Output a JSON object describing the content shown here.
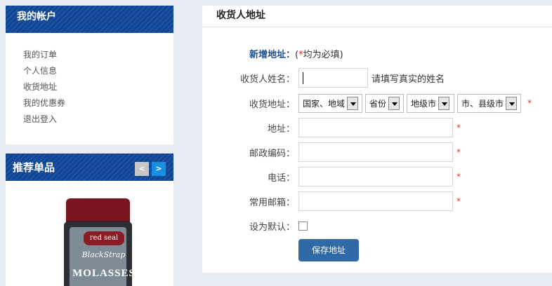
{
  "sidebar": {
    "account_title": "我的帐户",
    "account_items": [
      {
        "label": "我的订单"
      },
      {
        "label": "个人信息"
      },
      {
        "label": "收货地址"
      },
      {
        "label": "我的优惠券"
      },
      {
        "label": "退出登入"
      }
    ],
    "recommend_title": "推荐单品",
    "prev_label": "<",
    "next_label": ">",
    "product": {
      "brand": "red seal",
      "script": "BlackStrap",
      "name": "MOLASSES"
    }
  },
  "main": {
    "title": "收货人地址",
    "form": {
      "new_label": "新增地址：",
      "required_hint_open": "(",
      "required_star": "*",
      "required_hint": "均为必填)",
      "name_label": "收货人姓名：",
      "name_value": "",
      "name_hint": "请填写真实的姓名",
      "region_label": "收货地址：",
      "region_selects": [
        "国家、地域",
        "省份",
        "地级市",
        "市、县级市"
      ],
      "address_label": "地址：",
      "zip_label": "邮政编码：",
      "phone_label": "电话：",
      "email_label": "常用邮箱：",
      "default_label": "设为默认：",
      "default_checked": false,
      "required_mark": "*",
      "save_label": "保存地址"
    }
  }
}
